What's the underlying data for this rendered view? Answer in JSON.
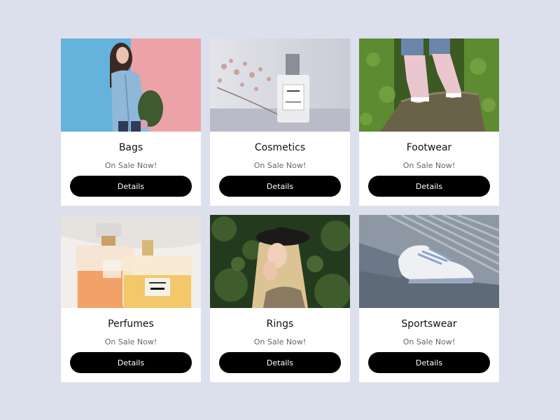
{
  "cards": [
    {
      "title": "Bags",
      "subtitle": "On Sale Now!",
      "button_label": "Details"
    },
    {
      "title": "Cosmetics",
      "subtitle": "On Sale Now!",
      "button_label": "Details"
    },
    {
      "title": "Footwear",
      "subtitle": "On Sale Now!",
      "button_label": "Details"
    },
    {
      "title": "Perfumes",
      "subtitle": "On Sale Now!",
      "button_label": "Details"
    },
    {
      "title": "Rings",
      "subtitle": "On Sale Now!",
      "button_label": "Details"
    },
    {
      "title": "Sportswear",
      "subtitle": "On Sale Now!",
      "button_label": "Details"
    }
  ],
  "theme": {
    "background": "#dcdfec",
    "card_background": "#ffffff",
    "button_background": "#000000",
    "button_text": "#ffffff"
  }
}
